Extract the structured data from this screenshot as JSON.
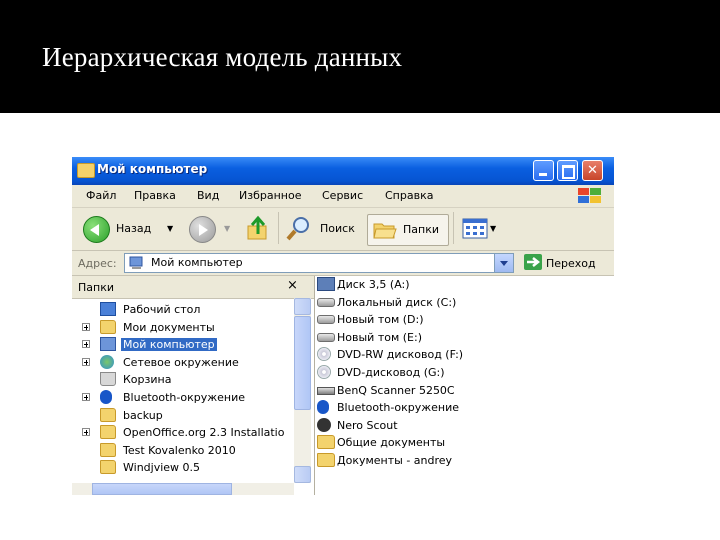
{
  "slide": {
    "title": "Иерархическая модель данных"
  },
  "window": {
    "title": "Мой компьютер"
  },
  "menu": [
    "Файл",
    "Правка",
    "Вид",
    "Избранное",
    "Сервис",
    "Справка"
  ],
  "toolbar": {
    "back": "Назад",
    "search": "Поиск",
    "folders": "Папки"
  },
  "address": {
    "label": "Адрес:",
    "value": "Мой компьютер",
    "go": "Переход"
  },
  "folders_panel": {
    "header": "Папки",
    "close": "×",
    "items": [
      {
        "label": "Рабочий стол",
        "icon": "desktop-icon",
        "expander": false,
        "selected": false
      },
      {
        "label": "Мои документы",
        "icon": "my-documents-icon",
        "expander": true,
        "selected": false
      },
      {
        "label": "Мой компьютер",
        "icon": "computer-icon",
        "expander": true,
        "selected": true
      },
      {
        "label": "Сетевое окружение",
        "icon": "network-icon",
        "expander": true,
        "selected": false
      },
      {
        "label": "Корзина",
        "icon": "recycle-bin-icon",
        "expander": false,
        "selected": false
      },
      {
        "label": "Bluetooth-окружение",
        "icon": "bluetooth-icon",
        "expander": true,
        "selected": false
      },
      {
        "label": "backup",
        "icon": "folder-icon",
        "expander": false,
        "selected": false
      },
      {
        "label": "OpenOffice.org 2.3 Installatio",
        "icon": "folder-icon",
        "expander": true,
        "selected": false
      },
      {
        "label": "Test Kovalenko 2010",
        "icon": "folder-icon",
        "expander": false,
        "selected": false
      },
      {
        "label": "Windjview 0.5",
        "icon": "folder-icon",
        "expander": false,
        "selected": false
      }
    ]
  },
  "file_list": [
    {
      "label": "Диск 3,5 (A:)",
      "icon": "floppy-icon"
    },
    {
      "label": "Локальный диск (C:)",
      "icon": "hard-drive-icon"
    },
    {
      "label": "Новый том (D:)",
      "icon": "hard-drive-icon"
    },
    {
      "label": "Новый том (E:)",
      "icon": "hard-drive-icon"
    },
    {
      "label": "DVD-RW дисковод (F:)",
      "icon": "dvd-drive-icon"
    },
    {
      "label": "DVD-дисковод (G:)",
      "icon": "dvd-drive-icon"
    },
    {
      "label": "BenQ Scanner 5250C",
      "icon": "scanner-icon"
    },
    {
      "label": "Bluetooth-окружение",
      "icon": "bluetooth-icon"
    },
    {
      "label": "Nero Scout",
      "icon": "nero-icon"
    },
    {
      "label": "Общие документы",
      "icon": "folder-icon"
    },
    {
      "label": "Документы - andrey",
      "icon": "folder-icon"
    }
  ],
  "colors": {
    "title_bar": "#0654d2",
    "selection": "#316ac5",
    "chrome": "#ece9d8"
  }
}
